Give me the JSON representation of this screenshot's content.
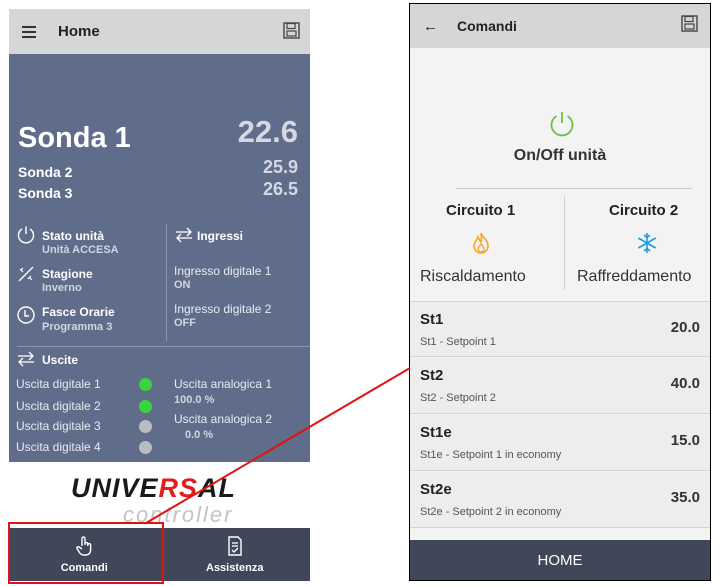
{
  "left_screen": {
    "title": "Home",
    "probes": [
      {
        "label": "Sonda 1",
        "value": "22.6"
      },
      {
        "label": "Sonda 2",
        "value": "25.9"
      },
      {
        "label": "Sonda 3",
        "value": "26.5"
      }
    ],
    "status": {
      "stato_label": "Stato unità",
      "stato_value": "Unità ACCESA",
      "stagione_label": "Stagione",
      "stagione_value": "Inverno",
      "fasce_label": "Fasce Orarie",
      "fasce_value": "Programma 3"
    },
    "ingressi": {
      "title": "Ingressi",
      "items": [
        {
          "label": "Ingresso digitale 1",
          "value": "ON"
        },
        {
          "label": "Ingresso digitale 2",
          "value": "OFF"
        }
      ]
    },
    "uscite": {
      "title": "Uscite",
      "digital": [
        {
          "label": "Uscita digitale 1",
          "state": "on"
        },
        {
          "label": "Uscita digitale 2",
          "state": "on"
        },
        {
          "label": "Uscita digitale 3",
          "state": "off"
        },
        {
          "label": "Uscita digitale 4",
          "state": "off"
        }
      ],
      "analog": [
        {
          "label": "Uscita analogica 1",
          "value": "100.0 %"
        },
        {
          "label": "Uscita analogica 2",
          "value": "0.0 %"
        }
      ]
    },
    "brand": {
      "word_a": "UNIVE",
      "word_red": "RS",
      "word_b": "AL",
      "subtitle": "controller"
    },
    "nav": [
      {
        "label": "Comandi",
        "icon": "hand-pointer-icon"
      },
      {
        "label": "Assistenza",
        "icon": "document-checklist-icon"
      }
    ]
  },
  "right_screen": {
    "title": "Comandi",
    "onoff_label": "On/Off unità",
    "circuits": [
      {
        "title": "Circuito 1",
        "mode": "Riscaldamento",
        "icon": "flame-icon"
      },
      {
        "title": "Circuito 2",
        "mode": "Raffreddamento",
        "icon": "snowflake-icon"
      }
    ],
    "setpoints": [
      {
        "name": "St1",
        "desc": "St1 - Setpoint 1",
        "value": "20.0"
      },
      {
        "name": "St2",
        "desc": "St2 - Setpoint 2",
        "value": "40.0"
      },
      {
        "name": "St1e",
        "desc": "St1e - Setpoint 1 in economy",
        "value": "15.0"
      },
      {
        "name": "St2e",
        "desc": "St2e - Setpoint 2 in economy",
        "value": "35.0"
      }
    ],
    "home_label": "HOME"
  },
  "colors": {
    "panel_bg": "#5f6d8a",
    "nav_bg": "#404758",
    "toolbar_bg": "#d5d6d8",
    "highlight_red": "#e01313",
    "output_on": "#3cd43c",
    "output_off": "#b9bcc2",
    "power_green": "#6cc04a",
    "flame_orange": "#f5a623",
    "snow_blue": "#1e9be0"
  }
}
